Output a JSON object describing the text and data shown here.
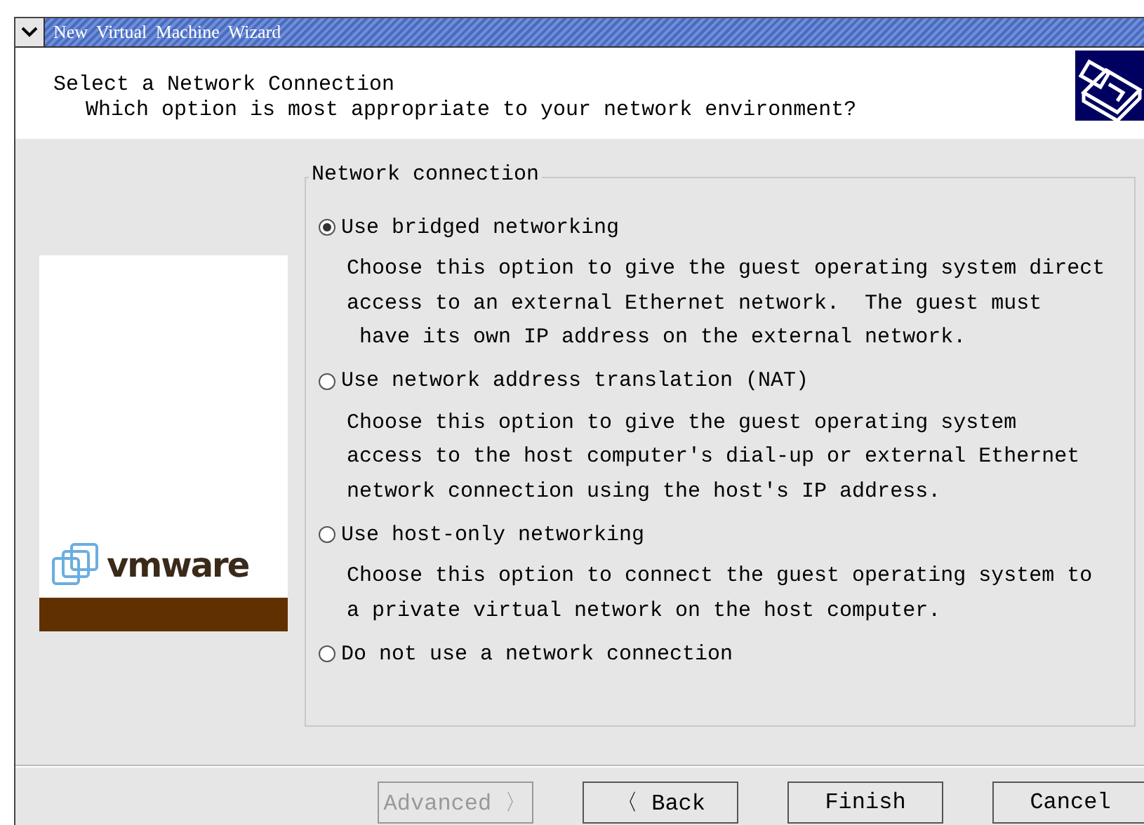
{
  "window": {
    "title": "New Virtual Machine Wizard"
  },
  "header": {
    "title": "Select a Network Connection",
    "subtitle": "Which option is most appropriate to your network environment?"
  },
  "sidebar": {
    "logo_text": "vmware"
  },
  "group": {
    "title": "Network connection",
    "options": [
      {
        "label": "Use bridged networking",
        "selected": true,
        "description": "Choose this option to give the guest operating system direct\naccess to an external Ethernet network.  The guest must\n have its own IP address on the external network."
      },
      {
        "label": "Use network address translation (NAT)",
        "selected": false,
        "description": "Choose this option to give the guest operating system\naccess to the host computer's dial-up or external Ethernet\nnetwork connection using the host's IP address."
      },
      {
        "label": "Use host-only networking",
        "selected": false,
        "description": "Choose this option to connect the guest operating system to\na private virtual network on the host computer."
      },
      {
        "label": "Do not use a network connection",
        "selected": false
      }
    ]
  },
  "buttons": [
    {
      "label": "Advanced 〉",
      "disabled": true
    },
    {
      "label": "〈 Back",
      "disabled": false
    },
    {
      "label": "Finish",
      "disabled": false
    },
    {
      "label": "Cancel",
      "disabled": false
    }
  ]
}
